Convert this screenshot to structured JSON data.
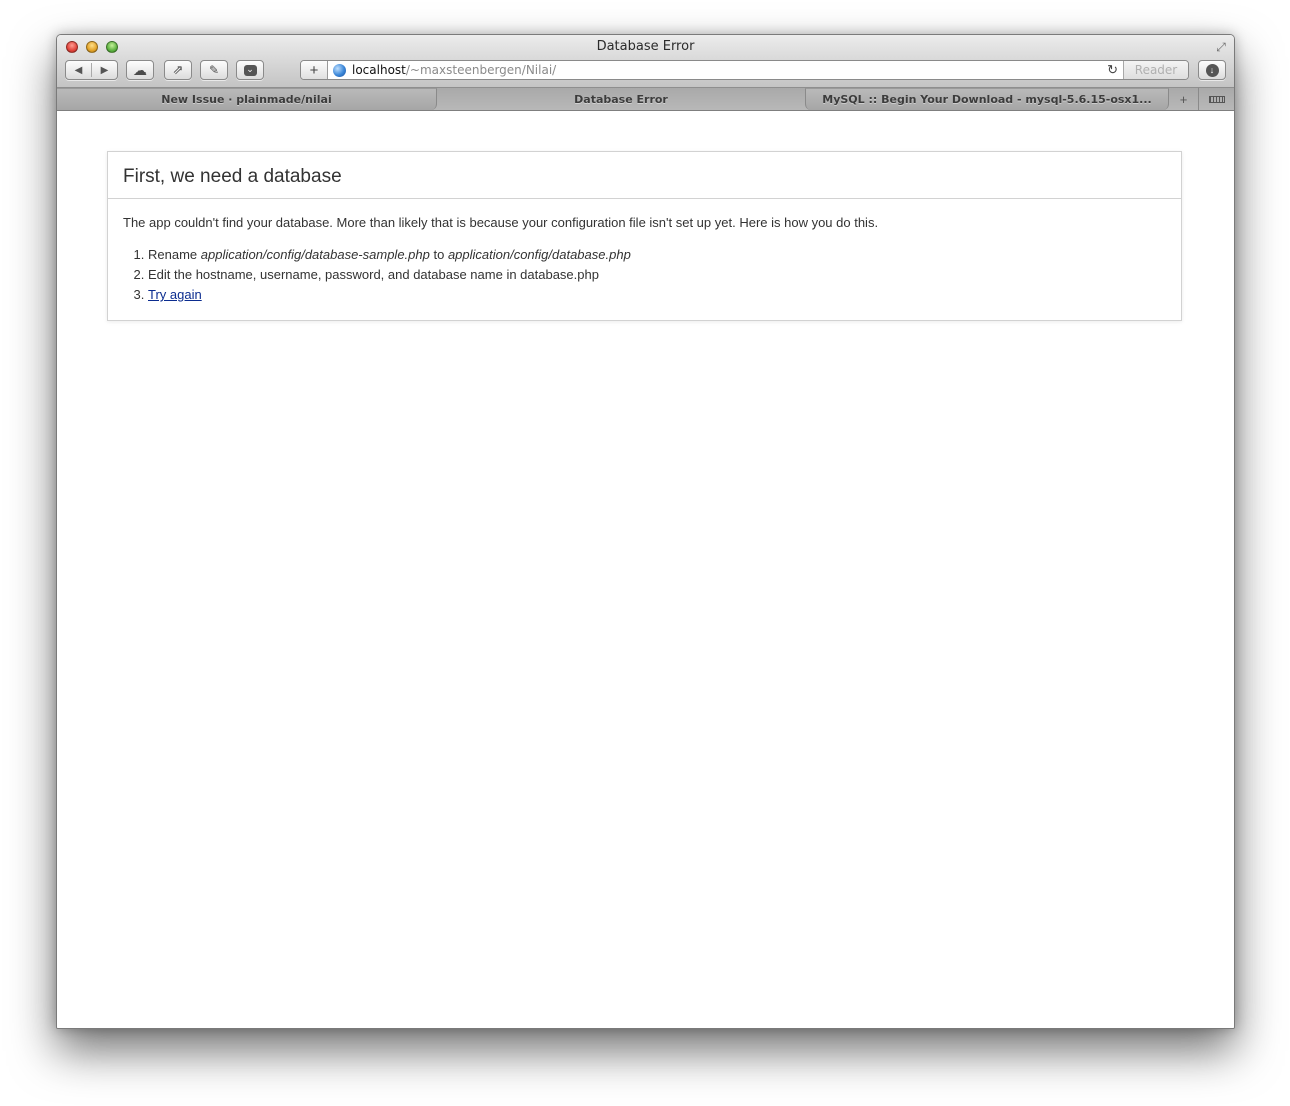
{
  "window": {
    "title": "Database Error",
    "icons": {
      "close": "close-light",
      "minimize": "minimize-light",
      "zoom": "zoom-light",
      "fullscreen": "fullscreen-arrows-icon"
    }
  },
  "toolbar": {
    "back_glyph": "◀",
    "forward_glyph": "▶",
    "icloud_glyph": "☁",
    "share_glyph": "⇗",
    "bookmark_glyph": "✎",
    "pocket_glyph": "⌄",
    "add_glyph": "+",
    "address": {
      "host": "localhost",
      "path": "/~maxsteenbergen/Nilai/"
    },
    "reload_glyph": "↻",
    "reader_label": "Reader",
    "download_glyph": "↓"
  },
  "tabs": [
    {
      "label": "New Issue · plainmade/nilai",
      "active": false
    },
    {
      "label": "Database Error",
      "active": true
    },
    {
      "label": "MySQL :: Begin Your Download - mysql-5.6.15-osx1...",
      "active": false
    }
  ],
  "tab_add_glyph": "+",
  "page": {
    "heading": "First, we need a database",
    "intro": "The app couldn't find your database. More than likely that is because your configuration file isn't set up yet. Here is how you do this.",
    "steps": {
      "step1": {
        "prefix": "Rename ",
        "from": "application/config/database-sample.php",
        "middle": " to ",
        "to": "application/config/database.php"
      },
      "step2": "Edit the hostname, username, password, and database name in database.php",
      "step3_link": "Try again"
    }
  }
}
